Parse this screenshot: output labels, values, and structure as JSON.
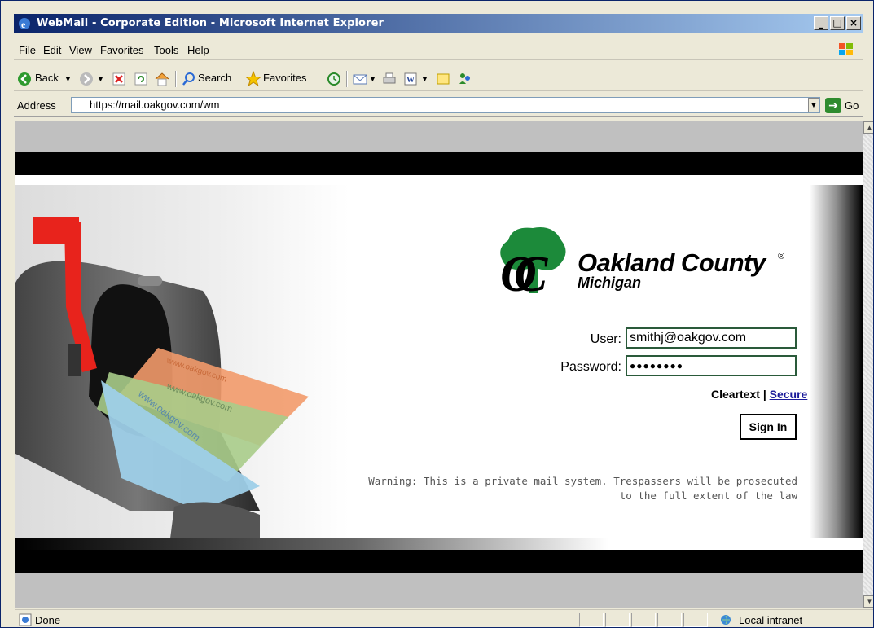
{
  "window": {
    "title": "WebMail - Corporate Edition - Microsoft Internet Explorer",
    "controls": {
      "minimize": "_",
      "maximize": "□",
      "close": "×"
    }
  },
  "menubar": {
    "items": [
      "File",
      "Edit",
      "View",
      "Favorites",
      "Tools",
      "Help"
    ]
  },
  "toolbar": {
    "back": "Back",
    "search": "Search",
    "favorites": "Favorites"
  },
  "address": {
    "label": "Address",
    "url": "https://mail.oakgov.com/wm",
    "go": "Go"
  },
  "page": {
    "logo": {
      "name": "Oakland County",
      "sub": "Michigan",
      "reg": "®"
    },
    "watermark": "www.oakgov.com",
    "form": {
      "user_label": "User:",
      "user_value": "smithj@oakgov.com",
      "password_label": "Password:",
      "password_value": "●●●●●●●●",
      "cleartext": "Cleartext",
      "divider": "|",
      "secure": "Secure",
      "signin": "Sign In"
    },
    "warning_line1": "Warning: This is a private mail system. Trespassers will be prosecuted",
    "warning_line2": "to the full extent of the law"
  },
  "status": {
    "text": "Done",
    "zone": "Local intranet"
  },
  "colors": {
    "titlebar_start": "#0a246a",
    "titlebar_end": "#a6caf0",
    "accent_green": "#2a5a3a",
    "secure_link": "#1a1a9a"
  }
}
